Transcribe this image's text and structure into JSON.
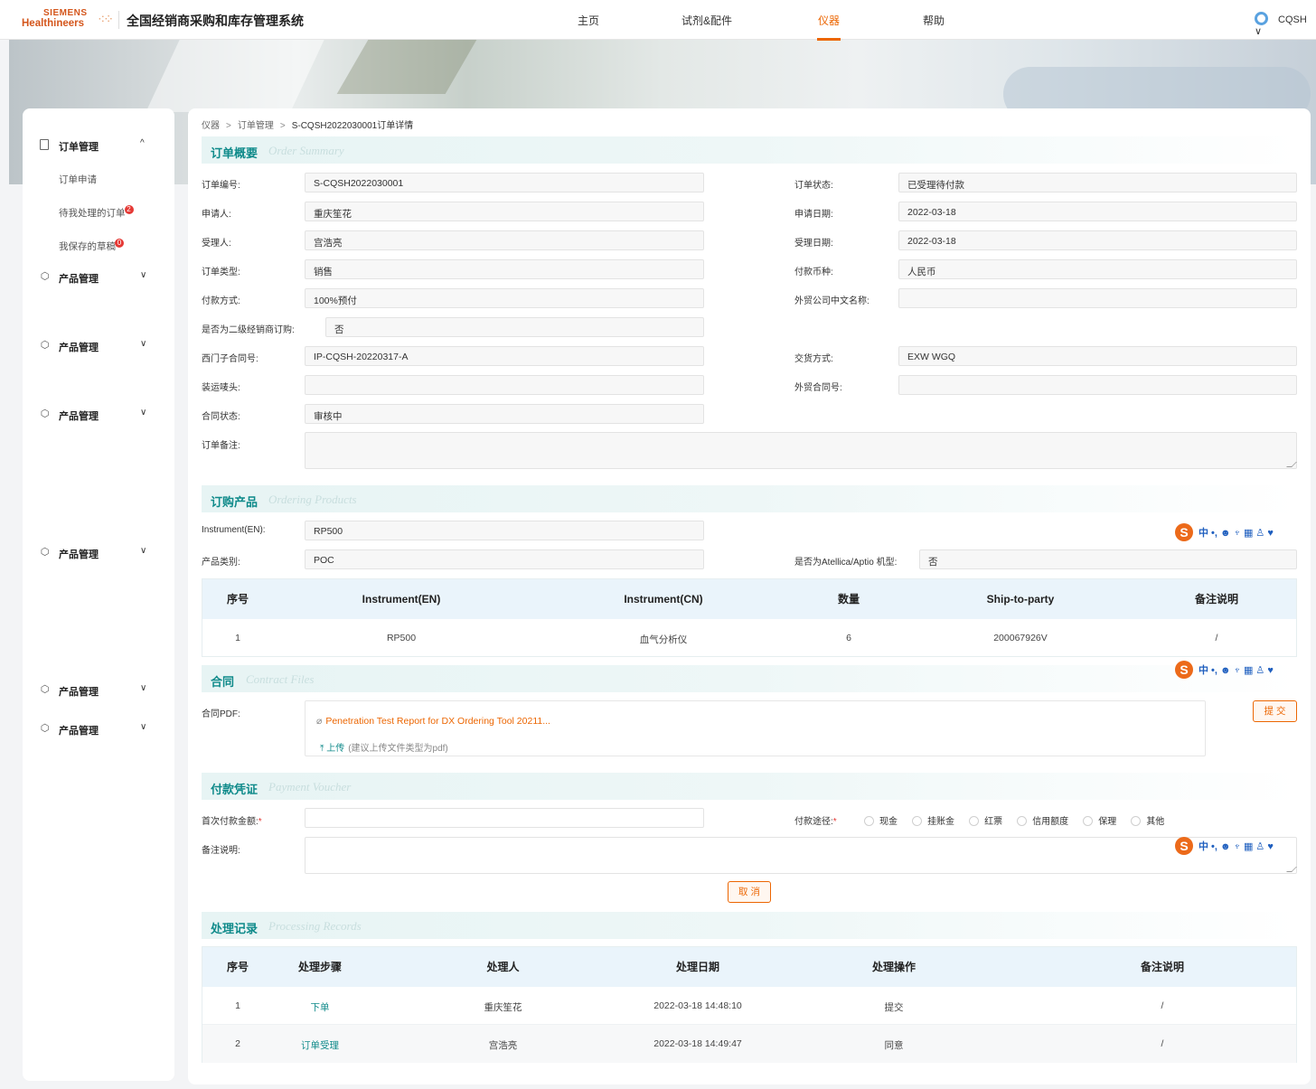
{
  "header": {
    "logo_top": "SIEMENS",
    "logo_bottom": "Healthineers",
    "app_title": "全国经销商采购和库存管理系统",
    "nav": [
      {
        "label": "主页",
        "active": false
      },
      {
        "label": "试剂&配件",
        "active": false
      },
      {
        "label": "仪器",
        "active": true
      },
      {
        "label": "帮助",
        "active": false
      }
    ],
    "user": "CQSH ∨"
  },
  "sidebar": {
    "group1": {
      "label": "订单管理",
      "chevron": "^",
      "items": [
        {
          "label": "订单申请"
        },
        {
          "label": "待我处理的订单",
          "badge": "2"
        },
        {
          "label": "我保存的草稿",
          "badge": "0"
        }
      ]
    },
    "groups": [
      {
        "label": "产品管理",
        "chevron": "∨"
      },
      {
        "label": "产品管理",
        "chevron": "∨"
      },
      {
        "label": "产品管理",
        "chevron": "∨"
      },
      {
        "label": "产品管理",
        "chevron": "∨"
      },
      {
        "label": "产品管理",
        "chevron": "∨"
      },
      {
        "label": "产品管理",
        "chevron": "∨"
      }
    ]
  },
  "breadcrumb": [
    "仪器",
    "订单管理",
    "S-CQSH2022030001订单详情"
  ],
  "summary": {
    "title_zh": "订单概要",
    "title_en": "Order Summary",
    "order_no_label": "订单编号:",
    "order_no": "S-CQSH2022030001",
    "status_label": "订单状态:",
    "status": "已受理待付款",
    "applicant_label": "申请人:",
    "applicant": "重庆笙花",
    "apply_date_label": "申请日期:",
    "apply_date": "2022-03-18",
    "handler_label": "受理人:",
    "handler": "宫浩亮",
    "handle_date_label": "受理日期:",
    "handle_date": "2022-03-18",
    "order_type_label": "订单类型:",
    "order_type": "销售",
    "currency_label": "付款币种:",
    "currency": "人民币",
    "pay_method_label": "付款方式:",
    "pay_method": "100%预付",
    "foreign_co_label": "外贸公司中文名称:",
    "foreign_co": "",
    "secondary_label": "是否为二级经销商订购:",
    "secondary": "否",
    "contract_no_label": "西门子合同号:",
    "contract_no": "IP-CQSH-20220317-A",
    "delivery_label": "交货方式:",
    "delivery": "EXW WGQ",
    "shipping_mark_label": "装运唛头:",
    "shipping_mark": "",
    "foreign_contract_label": "外贸合同号:",
    "foreign_contract": "",
    "contract_status_label": "合同状态:",
    "contract_status": "审核中",
    "remark_label": "订单备注:",
    "remark": ""
  },
  "products": {
    "title_zh": "订购产品",
    "title_en": "Ordering Products",
    "instrument_label": "Instrument(EN):",
    "instrument": "RP500",
    "category_label": "产品类别:",
    "category": "POC",
    "atellica_label": "是否为Atellica/Aptio 机型:",
    "atellica": "否",
    "columns": [
      "序号",
      "Instrument(EN)",
      "Instrument(CN)",
      "数量",
      "Ship-to-party",
      "备注说明"
    ],
    "rows": [
      [
        "1",
        "RP500",
        "血气分析仪",
        "6",
        "200067926V",
        "/"
      ]
    ]
  },
  "contract": {
    "title_zh": "合同",
    "title_en": "Contract Files",
    "pdf_label": "合同PDF:",
    "file_name": "Penetration Test Report for DX Ordering Tool 20211...",
    "upload_label": "上传",
    "upload_hint": "(建议上传文件类型为pdf)",
    "submit_label": "提 交"
  },
  "payment": {
    "title_zh": "付款凭证",
    "title_en": "Payment Voucher",
    "first_amount_label": "首次付款金额:",
    "first_amount": "",
    "channel_label": "付款途径:",
    "channels": [
      "现金",
      "挂账金",
      "红票",
      "信用额度",
      "保理",
      "其他"
    ],
    "note_label": "备注说明:",
    "note": "",
    "cancel_label": "取 消"
  },
  "records": {
    "title_zh": "处理记录",
    "title_en": "Processing Records",
    "columns": [
      "序号",
      "处理步骤",
      "处理人",
      "处理日期",
      "处理操作",
      "备注说明"
    ],
    "rows": [
      [
        "1",
        "下单",
        "重庆笙花",
        "2022-03-18 14:48:10",
        "提交",
        "/"
      ],
      [
        "2",
        "订单受理",
        "宫浩亮",
        "2022-03-18 14:49:47",
        "同意",
        "/"
      ]
    ]
  },
  "ime": {
    "logo": "S",
    "glyphs": "中 •, ☻ ♆ ▦ ♙ ♥"
  },
  "colors": {
    "accent": "#ec6602",
    "teal": "#0f8a8a",
    "table_header": "#eaf4fb"
  }
}
